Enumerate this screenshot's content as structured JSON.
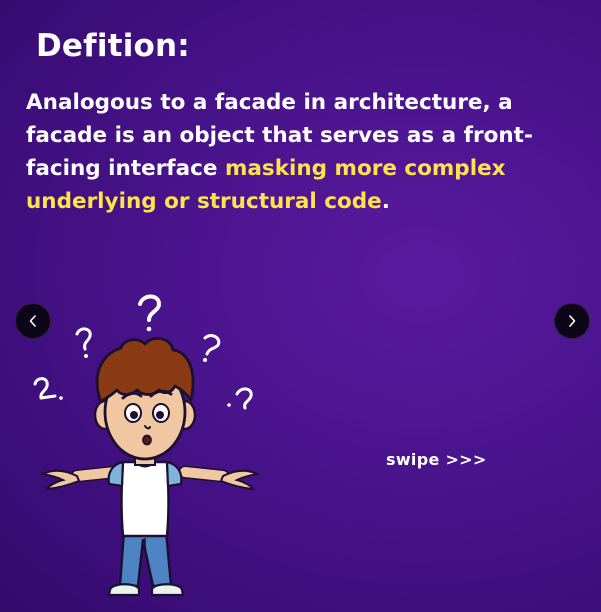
{
  "slide": {
    "title": "Defition:",
    "definition_plain": "Analogous to a facade in architecture, a facade is an object that serves as a front-facing interface ",
    "definition_highlight": "masking more complex underlying or structural code",
    "definition_end": ".",
    "swipe_label": "swipe >>>"
  },
  "nav": {
    "prev_icon": "chevron-left-icon",
    "next_icon": "chevron-right-icon"
  },
  "illustration": {
    "name": "confused-boy-illustration",
    "question_marks": [
      "?",
      "?",
      "?",
      "?",
      "?"
    ]
  },
  "colors": {
    "background": "#4c1590",
    "text": "#ffffff",
    "highlight": "#ffe34a",
    "nav_button": "#0c0618"
  }
}
